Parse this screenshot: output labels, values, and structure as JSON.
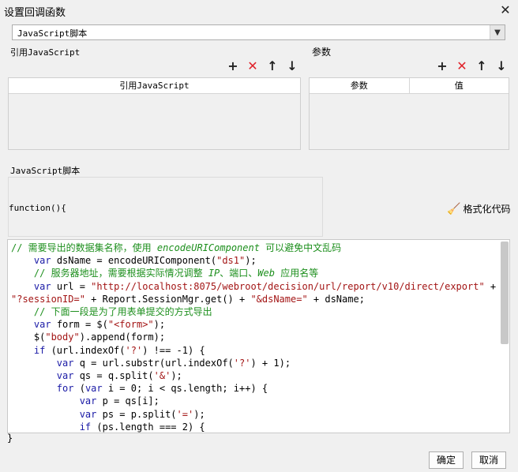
{
  "dialog": {
    "title": "设置回调函数"
  },
  "type_select": {
    "value": "JavaScript脚本"
  },
  "js_ref": {
    "label": "引用JavaScript",
    "column": "引用JavaScript"
  },
  "params": {
    "label": "参数",
    "columns": [
      "参数",
      "值"
    ]
  },
  "script": {
    "label": "JavaScript脚本",
    "signature": "function(){",
    "format_label": "格式化代码",
    "closing": "}"
  },
  "code_lines": [
    [
      {
        "t": "// 需要导出的数据集名称，使用 ",
        "c": "c-com"
      },
      {
        "t": "encodeURIComponent",
        "c": "c-com c-it"
      },
      {
        "t": " 可以避免中文乱码",
        "c": "c-com"
      }
    ],
    [
      {
        "t": "    "
      },
      {
        "t": "var",
        "c": "c-kw"
      },
      {
        "t": " dsName = encodeURIComponent("
      },
      {
        "t": "\"ds1\"",
        "c": "c-str"
      },
      {
        "t": ");"
      }
    ],
    [
      {
        "t": "    "
      },
      {
        "t": "// 服务器地址，需要根据实际情况调整 ",
        "c": "c-com"
      },
      {
        "t": "IP",
        "c": "c-com c-it"
      },
      {
        "t": "、端口、",
        "c": "c-com"
      },
      {
        "t": "Web",
        "c": "c-com c-it"
      },
      {
        "t": " 应用名等",
        "c": "c-com"
      }
    ],
    [
      {
        "t": "    "
      },
      {
        "t": "var",
        "c": "c-kw"
      },
      {
        "t": " url = "
      },
      {
        "t": "\"http://localhost:8075/webroot/decision/url/report/v10/direct/export\"",
        "c": "c-str"
      },
      {
        "t": " +"
      }
    ],
    [
      {
        "t": "\"?sessionID=\"",
        "c": "c-str"
      },
      {
        "t": " + Report.SessionMgr.get() + "
      },
      {
        "t": "\"&dsName=\"",
        "c": "c-str"
      },
      {
        "t": " + dsName;"
      }
    ],
    [
      {
        "t": "    "
      },
      {
        "t": "// 下面一段是为了用表单提交的方式导出",
        "c": "c-com"
      }
    ],
    [
      {
        "t": "    "
      },
      {
        "t": "var",
        "c": "c-kw"
      },
      {
        "t": " form = $("
      },
      {
        "t": "\"<form>\"",
        "c": "c-str"
      },
      {
        "t": ");"
      }
    ],
    [
      {
        "t": "    $("
      },
      {
        "t": "\"body\"",
        "c": "c-str"
      },
      {
        "t": ").append(form);"
      }
    ],
    [
      {
        "t": "    "
      },
      {
        "t": "if",
        "c": "c-kw"
      },
      {
        "t": " (url.indexOf("
      },
      {
        "t": "'?'",
        "c": "c-str"
      },
      {
        "t": ") !== -1) {"
      }
    ],
    [
      {
        "t": "        "
      },
      {
        "t": "var",
        "c": "c-kw"
      },
      {
        "t": " q = url.substr(url.indexOf("
      },
      {
        "t": "'?'",
        "c": "c-str"
      },
      {
        "t": ") + 1);"
      }
    ],
    [
      {
        "t": "        "
      },
      {
        "t": "var",
        "c": "c-kw"
      },
      {
        "t": " qs = q.split("
      },
      {
        "t": "'&'",
        "c": "c-str"
      },
      {
        "t": ");"
      }
    ],
    [
      {
        "t": "        "
      },
      {
        "t": "for",
        "c": "c-kw"
      },
      {
        "t": " ("
      },
      {
        "t": "var",
        "c": "c-kw"
      },
      {
        "t": " i = 0; i < qs.length; i++) {"
      }
    ],
    [
      {
        "t": "            "
      },
      {
        "t": "var",
        "c": "c-kw"
      },
      {
        "t": " p = qs[i];"
      }
    ],
    [
      {
        "t": "            "
      },
      {
        "t": "var",
        "c": "c-kw"
      },
      {
        "t": " ps = p.split("
      },
      {
        "t": "'='",
        "c": "c-str"
      },
      {
        "t": ");"
      }
    ],
    [
      {
        "t": "            "
      },
      {
        "t": "if",
        "c": "c-kw"
      },
      {
        "t": " (ps.length === 2) {"
      }
    ]
  ],
  "footer": {
    "ok": "确定",
    "cancel": "取消"
  }
}
